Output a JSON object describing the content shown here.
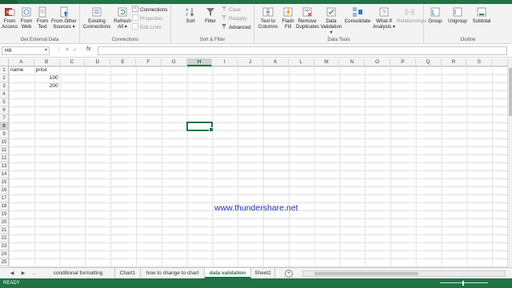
{
  "ribbon": {
    "groups": {
      "get_external_data": "Get External Data",
      "connections": "Connections",
      "sort_filter": "Sort & Filter",
      "data_tools": "Data Tools",
      "outline": "Outline"
    },
    "buttons": {
      "from_access": [
        "From",
        "Access"
      ],
      "from_web": [
        "From",
        "Web"
      ],
      "from_text": [
        "From",
        "Text"
      ],
      "from_other": [
        "From Other",
        "Sources ▾"
      ],
      "existing_connections": [
        "Existing",
        "Connections"
      ],
      "refresh_all": [
        "Refresh",
        "All ▾"
      ],
      "connections": "Connections",
      "properties": "Properties",
      "edit_links": "Edit Links",
      "sort": "Sort",
      "filter": "Filter",
      "clear": "Clear",
      "reapply": "Reapply",
      "advanced": "Advanced",
      "text_to_columns": [
        "Text to",
        "Columns"
      ],
      "flash_fill": [
        "Flash",
        "Fill"
      ],
      "remove_duplicates": [
        "Remove",
        "Duplicates"
      ],
      "data_validation": [
        "Data",
        "Validation ▾"
      ],
      "consolidate": "Consolidate",
      "what_if": [
        "What-If",
        "Analysis ▾"
      ],
      "relationships": "Relationships",
      "group": "Group",
      "ungroup": "Ungroup",
      "subtotal": "Subtotal"
    }
  },
  "formula_bar": {
    "name_box": "H8",
    "fx": "fx",
    "formula": ""
  },
  "grid": {
    "columns": [
      "A",
      "B",
      "C",
      "D",
      "E",
      "F",
      "G",
      "H",
      "I",
      "J",
      "K",
      "L",
      "M",
      "N",
      "O",
      "P",
      "Q",
      "R",
      "S"
    ],
    "rows": [
      "1",
      "2",
      "3",
      "4",
      "5",
      "6",
      "7",
      "8",
      "9",
      "10",
      "11",
      "12",
      "13",
      "14",
      "15",
      "16",
      "17",
      "18",
      "19",
      "20",
      "21",
      "22",
      "23",
      "24",
      "25"
    ],
    "selected_column": "H",
    "selected_row": "8",
    "cells": {
      "A1": "name",
      "B1": "price",
      "B2": "100",
      "B3": "200"
    }
  },
  "watermark": "www.thundershare.net",
  "sheet_tabs": {
    "nav_prev": "◀",
    "nav_next": "▶",
    "ellipsis": "...",
    "tabs": [
      "conditional formatting",
      "Chart1",
      "how to change to chart",
      "data validation",
      "Sheet2"
    ],
    "active": "data validation",
    "add": "+"
  },
  "status_bar": {
    "ready": "READY"
  },
  "colors": {
    "accent": "#217346",
    "watermark": "#1f2fb5"
  }
}
